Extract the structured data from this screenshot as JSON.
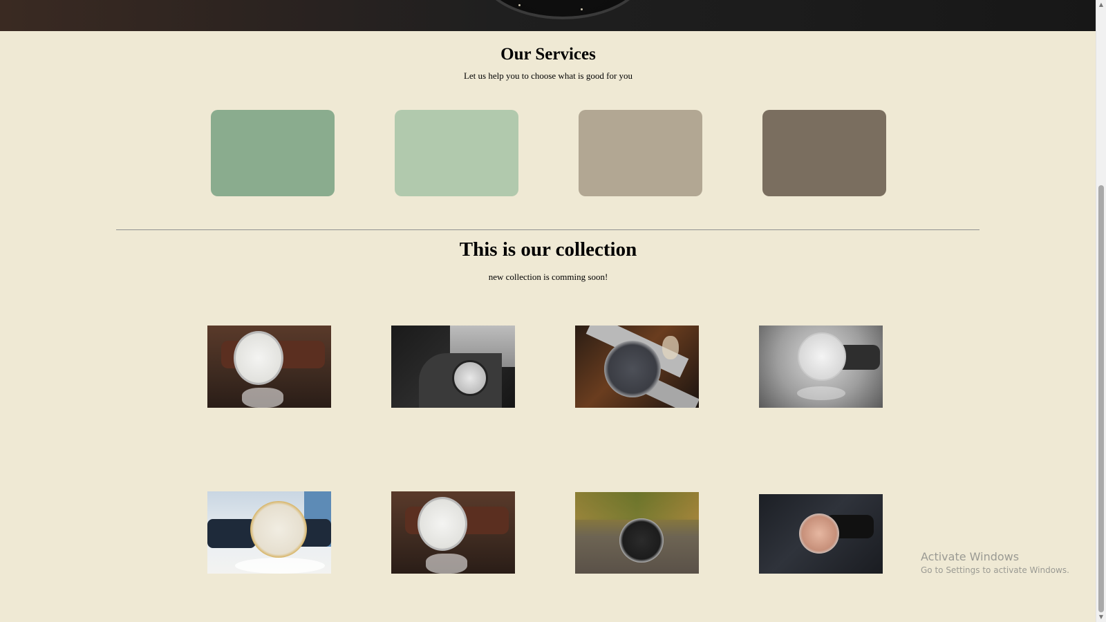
{
  "services": {
    "title": "Our Services",
    "subtitle": "Let us help you to choose what is good for you",
    "cards": [
      {
        "color": "#8aac8e"
      },
      {
        "color": "#b1c9ad"
      },
      {
        "color": "#b2a793"
      },
      {
        "color": "#7a6e5f"
      }
    ]
  },
  "collection": {
    "title": "This is our collection",
    "subtitle": "new collection is comming soon!",
    "products": [
      {
        "icon": "watch-photo-brown-leather-white-dial"
      },
      {
        "icon": "watch-photo-wrist-black-white"
      },
      {
        "icon": "watch-photo-steel-chronograph"
      },
      {
        "icon": "watch-photo-silver-grey-background"
      },
      {
        "icon": "watch-photo-gold-case-black-strap"
      },
      {
        "icon": "watch-photo-brown-leather-white-dial"
      },
      {
        "icon": "watch-photo-chronograph-on-stone"
      },
      {
        "icon": "watch-photo-rose-dial-on-fabric"
      }
    ]
  },
  "watermark": {
    "title": "Activate Windows",
    "subtitle": "Go to Settings to activate Windows."
  }
}
